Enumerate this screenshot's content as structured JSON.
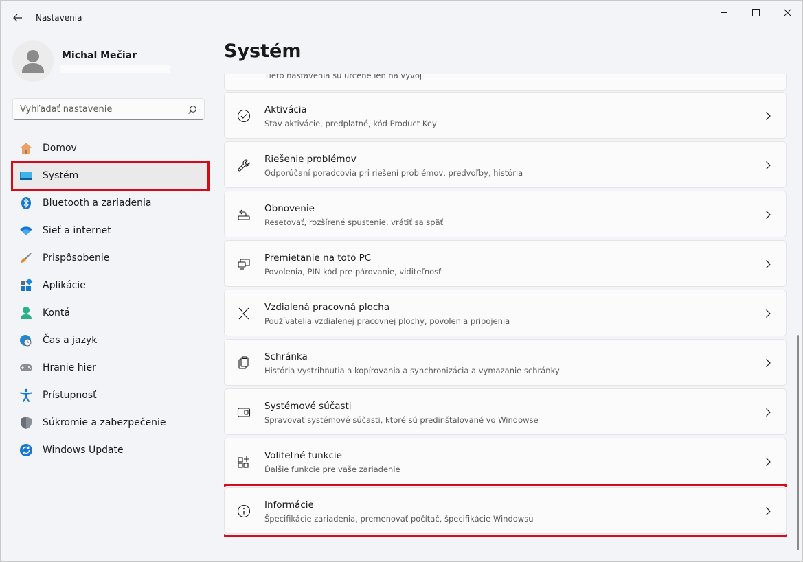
{
  "window": {
    "title": "Nastavenia"
  },
  "profile": {
    "name": "Michal Mečiar"
  },
  "search": {
    "placeholder": "Vyhľadať nastavenie"
  },
  "sidebar": {
    "items": [
      {
        "label": "Domov",
        "icon": "home-icon"
      },
      {
        "label": "Systém",
        "icon": "system-icon",
        "selected": true
      },
      {
        "label": "Bluetooth a zariadenia",
        "icon": "bluetooth-icon"
      },
      {
        "label": "Sieť a internet",
        "icon": "wifi-icon"
      },
      {
        "label": "Prispôsobenie",
        "icon": "brush-icon"
      },
      {
        "label": "Aplikácie",
        "icon": "apps-icon"
      },
      {
        "label": "Kontá",
        "icon": "account-icon"
      },
      {
        "label": "Čas a jazyk",
        "icon": "globe-clock-icon"
      },
      {
        "label": "Hranie hier",
        "icon": "gamepad-icon"
      },
      {
        "label": "Prístupnosť",
        "icon": "accessibility-icon"
      },
      {
        "label": "Súkromie a zabezpečenie",
        "icon": "shield-icon"
      },
      {
        "label": "Windows Update",
        "icon": "update-icon"
      }
    ]
  },
  "main": {
    "title": "Systém",
    "partial_card": {
      "title": "",
      "subtitle": "Tieto nastavenia sú určené len na vývoj"
    },
    "cards": [
      {
        "title": "Aktivácia",
        "subtitle": "Stav aktivácie, predplatné, kód Product Key",
        "icon": "activation-check-icon"
      },
      {
        "title": "Riešenie problémov",
        "subtitle": "Odporúčaní poradcovia pri riešení problémov, predvoľby, história",
        "icon": "wrench-icon"
      },
      {
        "title": "Obnovenie",
        "subtitle": "Resetovať, rozšírené spustenie, vrátiť sa späť",
        "icon": "recovery-icon"
      },
      {
        "title": "Premietanie na toto PC",
        "subtitle": "Povolenia, PIN kód pre párovanie, viditeľnosť",
        "icon": "projection-icon"
      },
      {
        "title": "Vzdialená pracovná plocha",
        "subtitle": "Používatelia vzdialenej pracovnej plochy, povolenia pripojenia",
        "icon": "remote-desktop-icon"
      },
      {
        "title": "Schránka",
        "subtitle": "História vystrihnutia a kopírovania a synchronizácia a vymazanie schránky",
        "icon": "clipboard-icon"
      },
      {
        "title": "Systémové súčasti",
        "subtitle": "Spravovať systémové súčasti, ktoré sú predinštalované vo Windowse",
        "icon": "system-components-icon"
      },
      {
        "title": "Voliteľné funkcie",
        "subtitle": "Ďalšie funkcie pre vaše zariadenie",
        "icon": "optional-features-icon"
      },
      {
        "title": "Informácie",
        "subtitle": "Špecifikácie zariadenia, premenovať počítač, špecifikácie Windowsu",
        "icon": "info-icon",
        "highlighted": true
      }
    ]
  },
  "colors": {
    "highlight_outline": "#d50b1d",
    "background": "#f3f4f7",
    "card": "#fbfbfc"
  }
}
